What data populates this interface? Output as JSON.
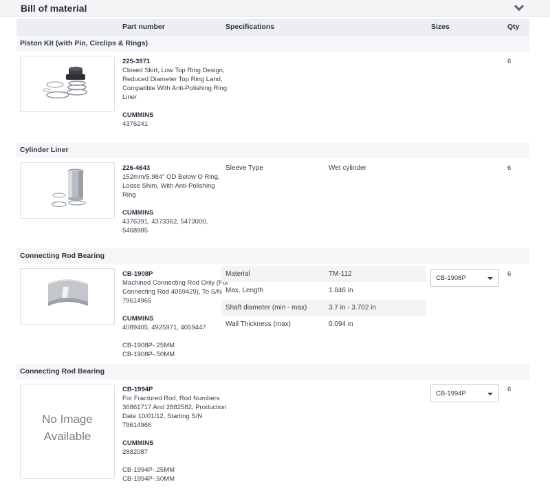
{
  "section": {
    "title": "Bill of material"
  },
  "columns": {
    "part_number": "Part number",
    "specifications": "Specifications",
    "sizes": "Sizes",
    "qty": "Qty"
  },
  "groups": [
    {
      "title": "Piston Kit (with Pin, Circlips & Rings)",
      "part_number": "225-3971",
      "description": [
        "Closed Skirt, Low Top Ring Design,",
        "Reduced Diameter Top Ring Land,",
        "Compatible With Anti-Polishing Ring",
        "Liner"
      ],
      "manufacturer": "CUMMINS",
      "oem_numbers": [
        "4376241"
      ],
      "qty": "6"
    },
    {
      "title": "Cylinder Liner",
      "part_number": "226-4643",
      "description": [
        "152mm/5.984\" OD Below O Ring,",
        "Loose Shim, With Anti-Polishing",
        "Ring"
      ],
      "manufacturer": "CUMMINS",
      "oem_numbers": [
        "4376391, 4373362, 5473000,",
        "5468985"
      ],
      "specs": [
        {
          "name": "Sleeve Type",
          "value": "Wet cylinder"
        }
      ],
      "qty": "6"
    },
    {
      "title": "Connecting Rod Bearing",
      "part_number": "CB-1908P",
      "description": [
        "Machined Connecting Rod Only (For",
        "Connecting Rod 4059429), To S/N",
        "79614965"
      ],
      "manufacturer": "CUMMINS",
      "oem_numbers": [
        "4089405, 4925971, 4059447"
      ],
      "variants": [
        "CB-1908P-.25MM",
        "CB-1908P-.50MM"
      ],
      "specs": [
        {
          "name": "Material",
          "value": "TM-112"
        },
        {
          "name": "Max. Length",
          "value": "1.846 in"
        },
        {
          "name": "Shaft diameter (min - max)",
          "value": "3.7 in - 3.702 in"
        },
        {
          "name": "Wall Thickness (max)",
          "value": "0.094 in"
        }
      ],
      "size_selected": "CB-1908P",
      "qty": "6"
    },
    {
      "title": "Connecting Rod Bearing",
      "part_number": "CB-1994P",
      "description": [
        "For Fractured Rod, Rod Numbers",
        "36861717 And 2882582, Production",
        "Date 10/01/12, Starting S/N",
        "79614966"
      ],
      "manufacturer": "CUMMINS",
      "oem_numbers": [
        "2882087"
      ],
      "variants": [
        "CB-1994P-.25MM",
        "CB-1994P-.50MM"
      ],
      "no_image": [
        "No Image",
        "Available"
      ],
      "size_selected": "CB-1994P",
      "qty": "6"
    }
  ],
  "colors": {
    "header_bg": "#eceef2",
    "group_bg": "#f5f6f8",
    "text": "#3a3f47"
  },
  "icons": {
    "collapse": "chevron-down-icon",
    "select": "caret-down-icon"
  }
}
